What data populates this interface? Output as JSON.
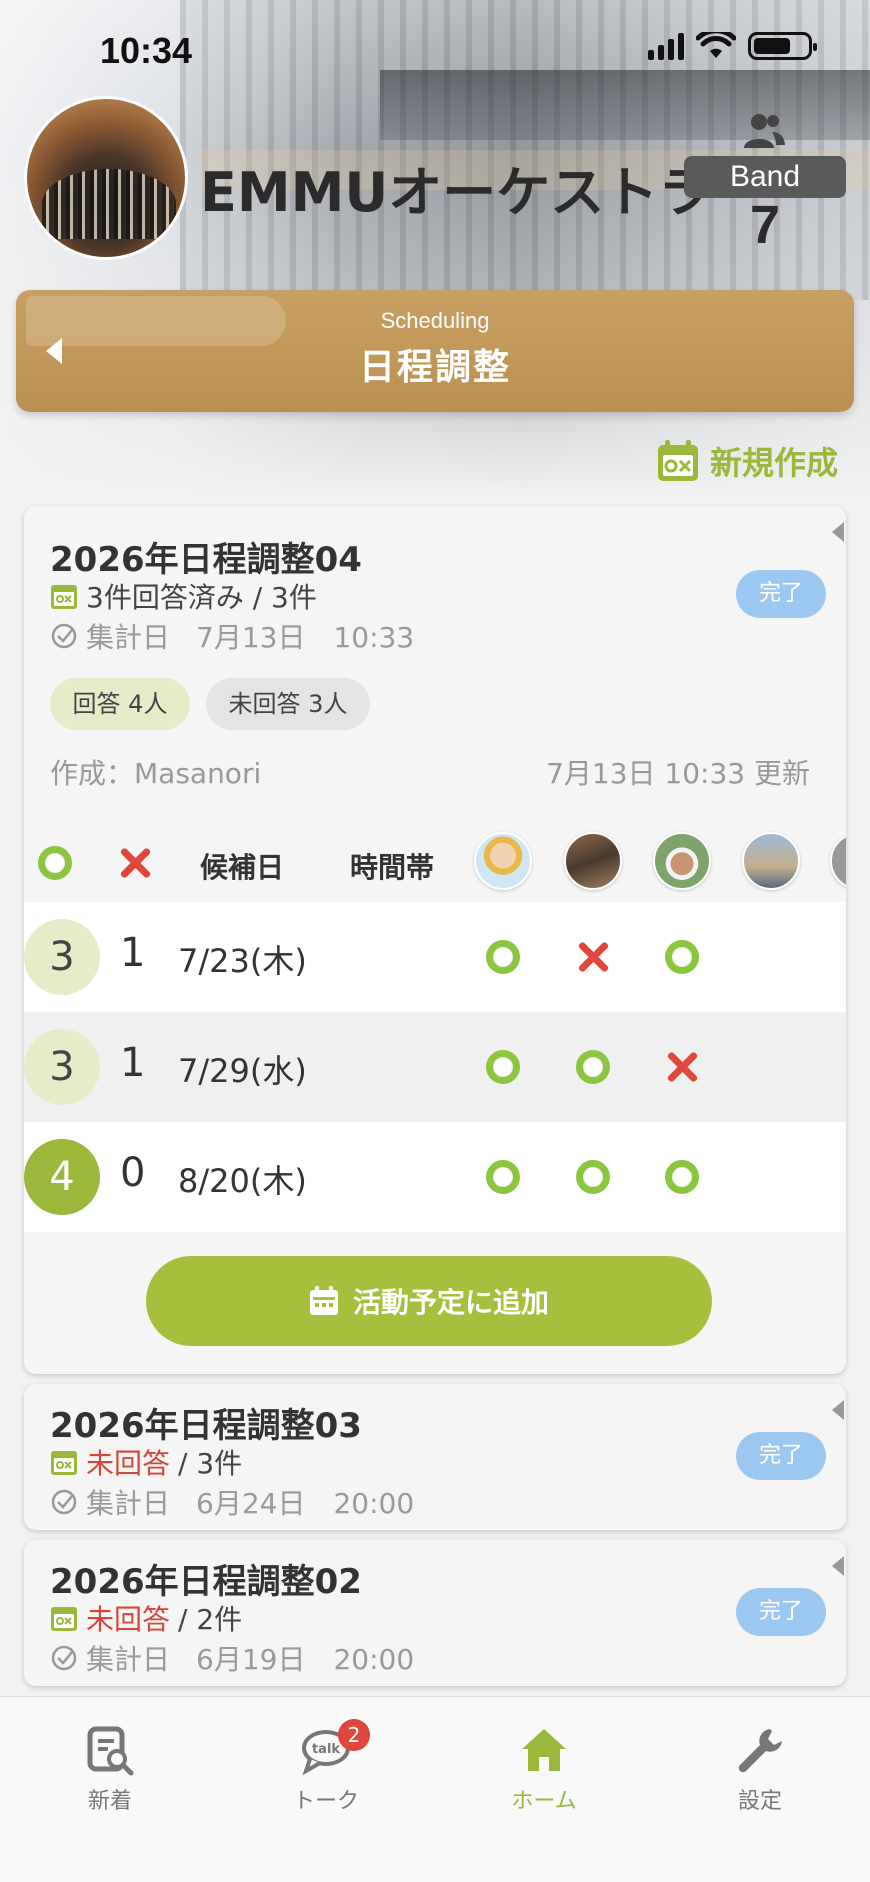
{
  "status": {
    "time": "10:34"
  },
  "group": {
    "name": "EMMUオーケストラ",
    "badge": "Band",
    "member_count": "7"
  },
  "header": {
    "subtitle": "Scheduling",
    "title": "日程調整"
  },
  "actions": {
    "new_label": "新規作成"
  },
  "cards": [
    {
      "title": "2026年日程調整04",
      "responses": "3件回答済み / 3件",
      "tally_label": "集計日",
      "tally_date": "7月13日　10:33",
      "status": "完了",
      "answered": "回答 4人",
      "unanswered": "未回答 3人",
      "creator": "作成：Masanori",
      "updated": "7月13日 10:33 更新"
    },
    {
      "title": "2026年日程調整03",
      "response_state": "未回答",
      "response_total": " / 3件",
      "tally_label": "集計日",
      "tally_date": "6月24日　20:00",
      "status": "完了"
    },
    {
      "title": "2026年日程調整02",
      "response_state": "未回答",
      "response_total": " / 2件",
      "tally_label": "集計日",
      "tally_date": "6月19日　20:00",
      "status": "完了"
    }
  ],
  "table": {
    "headers": {
      "candidate": "候補日",
      "time": "時間帯"
    },
    "rows": [
      {
        "ok": "3",
        "ng": "1",
        "date": "7/23(木)",
        "marks": [
          "o",
          "x",
          "o"
        ]
      },
      {
        "ok": "3",
        "ng": "1",
        "date": "7/29(水)",
        "marks": [
          "o",
          "o",
          "x"
        ]
      },
      {
        "ok": "4",
        "ng": "0",
        "date": "8/20(木)",
        "marks": [
          "o",
          "o",
          "o"
        ]
      }
    ]
  },
  "add_button": {
    "label": "活動予定に追加"
  },
  "tabs": [
    {
      "label": "新着",
      "icon": "news-search-icon"
    },
    {
      "label": "トーク",
      "icon": "talk-bubble-icon",
      "badge": "2"
    },
    {
      "label": "ホーム",
      "icon": "home-icon"
    },
    {
      "label": "設定",
      "icon": "wrench-icon"
    }
  ],
  "colors": {
    "accent": "#9ab83a",
    "banner": "#c09a5a",
    "done": "#9bc8f0",
    "negative": "#d9443a"
  }
}
